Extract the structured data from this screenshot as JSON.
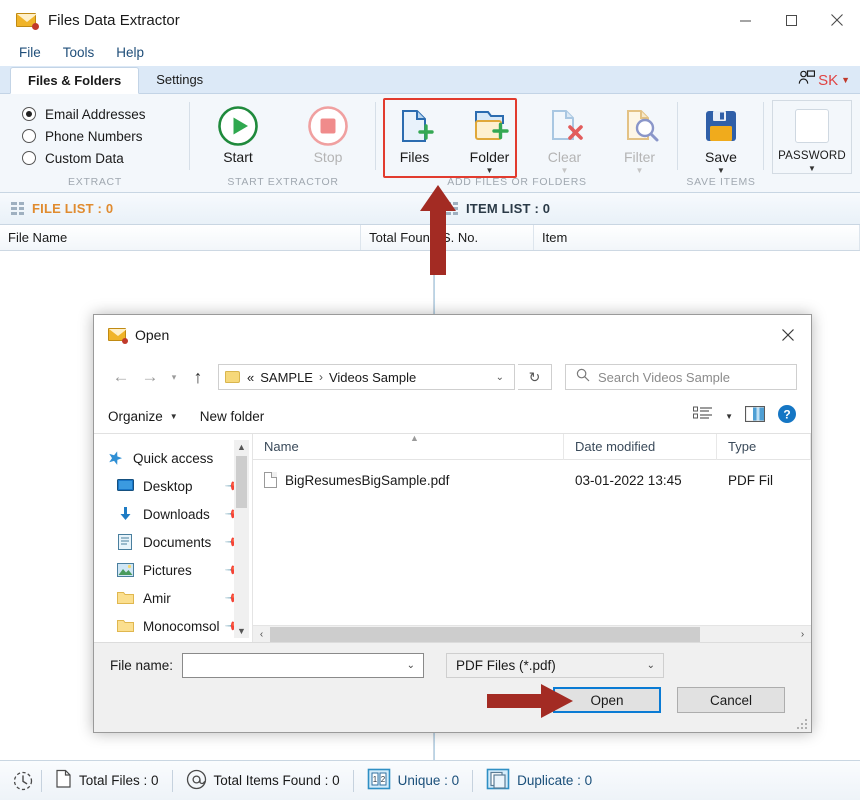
{
  "window": {
    "title": "Files Data Extractor",
    "icon": "mail-extract-icon",
    "minimize": "minimize-icon",
    "maximize": "maximize-icon",
    "close": "close-icon"
  },
  "menu": {
    "items": [
      "File",
      "Tools",
      "Help"
    ]
  },
  "tabs": {
    "items": [
      {
        "label": "Files & Folders",
        "active": true
      },
      {
        "label": "Settings",
        "active": false
      }
    ],
    "account": {
      "name": "SK",
      "caret": "▼",
      "color": "#e04343"
    }
  },
  "ribbon": {
    "extract": {
      "group_label": "EXTRACT",
      "options": [
        {
          "label": "Email Addresses",
          "selected": true
        },
        {
          "label": "Phone Numbers",
          "selected": false
        },
        {
          "label": "Custom Data",
          "selected": false
        }
      ]
    },
    "start_extractor": {
      "group_label": "START EXTRACTOR",
      "buttons": [
        {
          "label": "Start",
          "icon": "play-icon",
          "enabled": true
        },
        {
          "label": "Stop",
          "icon": "stop-icon",
          "enabled": false
        }
      ]
    },
    "add_files": {
      "group_label": "ADD FILES OR FOLDERS",
      "highlighted": true,
      "highlight_color": "#e23b2e",
      "buttons": [
        {
          "label": "Files",
          "icon": "file-add-icon",
          "enabled": true,
          "caret": false
        },
        {
          "label": "Folder",
          "icon": "folder-add-icon",
          "enabled": true,
          "caret": true
        },
        {
          "label": "Clear",
          "icon": "file-clear-icon",
          "enabled": false,
          "caret": true
        },
        {
          "label": "Filter",
          "icon": "file-filter-icon",
          "enabled": false,
          "caret": true
        }
      ]
    },
    "save_items": {
      "group_label": "SAVE ITEMS",
      "buttons": [
        {
          "label": "Save",
          "icon": "floppy-save-icon",
          "enabled": true,
          "caret": true
        }
      ]
    },
    "password": {
      "label": "PASSWORD",
      "caret": "▼",
      "icon": "password-box-icon"
    }
  },
  "file_list_panel": {
    "header": "FILE LIST : 0",
    "header_color": "#e08b2f",
    "columns": [
      "File Name",
      "Total Found"
    ],
    "rows": []
  },
  "item_list_panel": {
    "header": "ITEM LIST : 0",
    "header_color": "#2b3a47",
    "columns": [
      "S. No.",
      "Item"
    ],
    "rows": []
  },
  "status_bar": {
    "history_icon": "history-icon",
    "items": [
      {
        "icon": "file-icon",
        "label": "Total Files : 0",
        "accent": false
      },
      {
        "icon": "at-icon",
        "label": "Total Items Found : 0",
        "accent": false
      },
      {
        "icon": "unique-icon",
        "label": "Unique : 0",
        "accent": true
      },
      {
        "icon": "duplicate-icon",
        "label": "Duplicate : 0",
        "accent": true
      }
    ]
  },
  "open_dialog": {
    "title": "Open",
    "icon": "mail-extract-icon",
    "close": "close-icon",
    "nav": {
      "back": "arrow-left-icon",
      "forward": "arrow-right-icon",
      "recent": "chevron-down-icon",
      "up": "arrow-up-icon",
      "breadcrumb": [
        "«",
        "SAMPLE",
        "Videos Sample"
      ],
      "breadcrumb_caret": "⌄",
      "refresh": "refresh-icon"
    },
    "search": {
      "placeholder": "Search Videos Sample",
      "icon": "search-icon"
    },
    "toolbar": {
      "organize": "Organize",
      "organize_caret": "▼",
      "new_folder": "New folder",
      "view_icon": "view-list-icon",
      "view_caret": "▼",
      "preview_icon": "preview-pane-icon",
      "help_icon": "help-icon"
    },
    "sidebar": [
      {
        "label": "Quick access",
        "icon": "star-icon",
        "pinned": false,
        "root": true
      },
      {
        "label": "Desktop",
        "icon": "desktop-icon",
        "pinned": true
      },
      {
        "label": "Downloads",
        "icon": "download-icon",
        "pinned": true
      },
      {
        "label": "Documents",
        "icon": "documents-icon",
        "pinned": true
      },
      {
        "label": "Pictures",
        "icon": "pictures-icon",
        "pinned": true
      },
      {
        "label": "Amir",
        "icon": "folder-icon",
        "pinned": true
      },
      {
        "label": "Monocomsol",
        "icon": "folder-icon",
        "pinned": true
      }
    ],
    "file_columns": [
      "Name",
      "Date modified",
      "Type"
    ],
    "files": [
      {
        "name": "BigResumesBigSample.pdf",
        "date_modified": "03-01-2022 13:45",
        "type": "PDF Fil",
        "icon": "pdf-file-icon"
      }
    ],
    "footer": {
      "file_name_label": "File name:",
      "file_name_value": "",
      "file_name_caret": "⌄",
      "filter": "PDF Files (*.pdf)",
      "filter_caret": "⌄",
      "open_button": "Open",
      "cancel_button": "Cancel"
    }
  },
  "annotations": {
    "arrow_color": "#a32b23",
    "arrows": [
      {
        "name": "arrow-up-to-add-files",
        "direction": "up"
      },
      {
        "name": "arrow-right-to-open-button",
        "direction": "right"
      }
    ],
    "highlight_box": {
      "name": "add-files-highlight",
      "color": "#e23b2e"
    }
  }
}
